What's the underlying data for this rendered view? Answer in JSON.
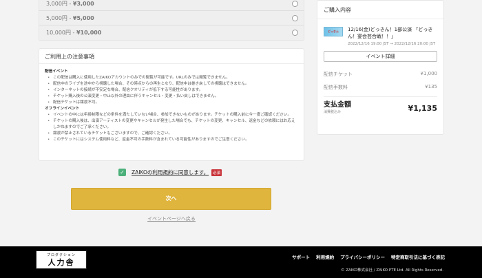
{
  "options": [
    {
      "label": "3,000円 - ",
      "price": "¥3,000"
    },
    {
      "label": "5,000円 - ",
      "price": "¥5,000"
    },
    {
      "label": "10,000円 - ",
      "price": "¥10,000"
    }
  ],
  "notes": {
    "title": "ご利用上の注意事項",
    "online_heading": "配信イベント",
    "online_items": [
      "この配信は購入に使用したZAIKOアカウントのみでの閲覧が可能です。URLのみでは閲覧できません。",
      "配信中のライブを途中から視聴した場合、その時点からの再生となり、配信中は巻き戻しての視聴はできません。",
      "インターネットの接続が不安定な場合、配信クオリティが低下する可能性があります。",
      "チケット購入後の公演変更・中止以外の理由に伴うキャンセル・変更・払い戻しはできません。",
      "配信チケットは譲渡不可。"
    ],
    "offline_heading": "オフラインイベント",
    "offline_items": [
      "イベントの中には年齢制限などの条件を満たしていない場合、参加できないものがあります。チケットの購入前に今一度ご確認ください。",
      "チケットの購入後は、出演アーティストの変更やキャンセルが発生した場合でも、チケットの変更、キャンセル、返金などの依頼にはお応えしかねますのでご了承ください。",
      "譲渡が禁止されているチケットもございますので、ご確認ください。",
      "このチケットにはシステム使用料など、返金不可の手数料が含まれている可能性がありますのでご注意ください。"
    ]
  },
  "agreement": {
    "link_text": "ZAIKOの利用規約に同意します。",
    "required": "必須"
  },
  "next_button": "次へ",
  "back_link": "イベントページへ戻る",
  "summary": {
    "title": "ご購入内容",
    "thumb_text": "どっきん",
    "event_title": "12/16(金)どっきん！1部公演 「どっきん！宴会芸合戦！！」",
    "event_date": "2022/12/16 19:00 JST → 2022/12/16 20:00 JST",
    "detail_button": "イベント詳細",
    "ticket_label": "配信チケット",
    "ticket_price": "¥1,000",
    "fee_label": "配信手数料",
    "fee_price": "¥135",
    "total_label": "支払金額",
    "tax_label": "消費税込み",
    "total_price": "¥1,135"
  },
  "footer": {
    "logo_small": "プロダクション",
    "logo_big": "人力舎",
    "links": [
      "サポート",
      "利用規約",
      "プライバシーポリシー",
      "特定商取引法に基づく表記"
    ],
    "copyright": "© ZAIKO株式会社 / ZAIKO PTE Ltd. All Rights Reserved."
  },
  "colors": {
    "accent_button": "#e0b53d",
    "checkbox": "#4cb07a",
    "required_badge": "#c8343a"
  }
}
